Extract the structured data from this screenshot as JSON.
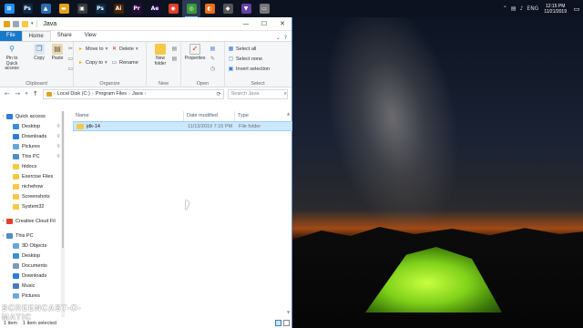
{
  "taskbar": {
    "apps": [
      {
        "icon": "windows-start-icon",
        "color": "#1e90ff",
        "glyph": "⊞"
      },
      {
        "icon": "photoshop-icon",
        "color": "#0b2a4a",
        "glyph": "Ps"
      },
      {
        "icon": "photos-icon",
        "color": "#2b6cb0",
        "glyph": "▲"
      },
      {
        "icon": "explorer-icon",
        "color": "#e3a21a",
        "glyph": "▬"
      },
      {
        "icon": "adobe-icon",
        "color": "#3a3a3a",
        "glyph": "▣"
      },
      {
        "icon": "photoshop-icon",
        "color": "#0b2a4a",
        "glyph": "Ps"
      },
      {
        "icon": "illustrator-icon",
        "color": "#4a2200",
        "glyph": "Ai"
      },
      {
        "icon": "premiere-icon",
        "color": "#2a0a3a",
        "glyph": "Pr"
      },
      {
        "icon": "after-effects-icon",
        "color": "#1a0a3a",
        "glyph": "Ae"
      },
      {
        "icon": "app-icon",
        "color": "#e0402a",
        "glyph": "◉"
      },
      {
        "icon": "chrome-icon",
        "color": "#3a9a3a",
        "glyph": "◎"
      },
      {
        "icon": "firefox-icon",
        "color": "#e8701a",
        "glyph": "◐"
      },
      {
        "icon": "app-icon",
        "color": "#555555",
        "glyph": "◆"
      },
      {
        "icon": "twitch-icon",
        "color": "#6441a5",
        "glyph": "▼"
      },
      {
        "icon": "app-icon",
        "color": "#777777",
        "glyph": "▭"
      }
    ],
    "active_index": 10,
    "tray": {
      "language": "ENG",
      "time": "12:15 PM",
      "date": "11/21/2019"
    }
  },
  "explorer": {
    "title": "Java",
    "ribbon_tabs": [
      "File",
      "Home",
      "Share",
      "View"
    ],
    "clipboard": {
      "pin": "Pin to Quick access",
      "copy": "Copy",
      "paste": "Paste",
      "group": "Clipboard"
    },
    "organize": {
      "move_to": "Move to",
      "copy_to": "Copy to",
      "delete": "Delete",
      "rename": "Rename",
      "group": "Organize"
    },
    "new": {
      "new_folder": "New folder",
      "group": "New"
    },
    "open": {
      "properties": "Properties",
      "group": "Open"
    },
    "select": {
      "select_all": "Select all",
      "select_none": "Select none",
      "invert": "Invert selection",
      "group": "Select"
    },
    "address": {
      "crumbs": [
        "Local Disk (C:)",
        "Program Files",
        "Java"
      ]
    },
    "search_placeholder": "Search Java",
    "columns": [
      "Name",
      "Date modified",
      "Type"
    ],
    "files": [
      {
        "name": "jdk-14",
        "date": "11/13/2019 7:15 PM",
        "type": "File folder"
      }
    ],
    "nav": [
      {
        "label": "Quick access",
        "kind": "section",
        "icon_color": "#2e7cd6",
        "pinned": false
      },
      {
        "label": "Desktop",
        "kind": "item",
        "icon_color": "#3b8ed8",
        "pinned": true
      },
      {
        "label": "Downloads",
        "kind": "item",
        "icon_color": "#2e7cd6",
        "pinned": true
      },
      {
        "label": "Pictures",
        "kind": "item",
        "icon_color": "#6aa6d8",
        "pinned": true
      },
      {
        "label": "This PC",
        "kind": "item",
        "icon_color": "#4a90c8",
        "pinned": true
      },
      {
        "label": "htdocs",
        "kind": "item",
        "icon_color": "#f7c948",
        "pinned": false
      },
      {
        "label": "Exercise Files",
        "kind": "item",
        "icon_color": "#f7c948",
        "pinned": false
      },
      {
        "label": "nichehow",
        "kind": "item",
        "icon_color": "#f7c948",
        "pinned": false
      },
      {
        "label": "Screenshots",
        "kind": "item",
        "icon_color": "#f7c948",
        "pinned": false
      },
      {
        "label": "System32",
        "kind": "item",
        "icon_color": "#f7c948",
        "pinned": false
      },
      {
        "label": "",
        "kind": "spacer",
        "icon_color": "",
        "pinned": false
      },
      {
        "label": "Creative Cloud Fil",
        "kind": "section",
        "icon_color": "#e0402a",
        "pinned": false
      },
      {
        "label": "",
        "kind": "spacer",
        "icon_color": "",
        "pinned": false
      },
      {
        "label": "This PC",
        "kind": "section",
        "icon_color": "#4a90c8",
        "pinned": false
      },
      {
        "label": "3D Objects",
        "kind": "item",
        "icon_color": "#5fa8e0",
        "pinned": false
      },
      {
        "label": "Desktop",
        "kind": "item",
        "icon_color": "#3b8ed8",
        "pinned": false
      },
      {
        "label": "Documents",
        "kind": "item",
        "icon_color": "#7a9ab8",
        "pinned": false
      },
      {
        "label": "Downloads",
        "kind": "item",
        "icon_color": "#2e7cd6",
        "pinned": false
      },
      {
        "label": "Music",
        "kind": "item",
        "icon_color": "#4a7ab8",
        "pinned": false
      },
      {
        "label": "Pictures",
        "kind": "item",
        "icon_color": "#6aa6d8",
        "pinned": false
      }
    ],
    "status": {
      "count": "1 item",
      "selected": "1 item selected"
    }
  },
  "watermark": {
    "small": "RECORDED WITH",
    "big": "SCREENCAST-O-MATIC"
  }
}
